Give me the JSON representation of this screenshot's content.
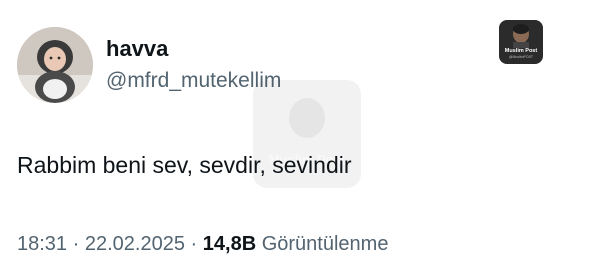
{
  "tweet": {
    "author": {
      "display_name": "havva",
      "handle": "@mfrd_mutekellim"
    },
    "text": "Rabbim beni sev, sevdir, sevindir",
    "time": "18:31",
    "date": "22.02.2025",
    "separator": "·",
    "view_count": "14,8B",
    "views_label": "Görüntülenme"
  },
  "watermark": {
    "title": "Muslim Post",
    "subtitle": "@MuslimPOST"
  },
  "icons": {
    "avatar": "profile-photo",
    "watermark_logo": "muslim-post-logo"
  }
}
